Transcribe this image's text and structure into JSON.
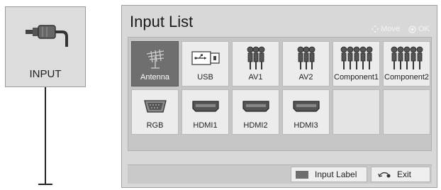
{
  "remote_button": {
    "label": "INPUT",
    "icon": "input-plug-icon"
  },
  "panel": {
    "title": "Input List",
    "hints": {
      "move": "Move",
      "ok": "OK"
    },
    "row1": [
      {
        "label": "Antenna",
        "icon": "antenna-icon",
        "selected": true
      },
      {
        "label": "USB",
        "icon": "usb-icon",
        "selected": false
      },
      {
        "label": "AV1",
        "icon": "av-connector-icon",
        "selected": false
      },
      {
        "label": "AV2",
        "icon": "av-connector-icon",
        "selected": false
      },
      {
        "label": "Component1",
        "icon": "component-connector-icon",
        "selected": false
      },
      {
        "label": "Component2",
        "icon": "component-connector-icon",
        "selected": false
      }
    ],
    "row2": [
      {
        "label": "RGB",
        "icon": "rgb-port-icon",
        "selected": false
      },
      {
        "label": "HDMI1",
        "icon": "hdmi-port-icon",
        "selected": false
      },
      {
        "label": "HDMI2",
        "icon": "hdmi-port-icon",
        "selected": false
      },
      {
        "label": "HDMI3",
        "icon": "hdmi-port-icon",
        "selected": false
      },
      {
        "label": "",
        "icon": "",
        "selected": false
      },
      {
        "label": "",
        "icon": "",
        "selected": false
      }
    ],
    "bottom": {
      "input_label": "Input Label",
      "exit": "Exit"
    }
  },
  "colors": {
    "selected_tile": "#6f6f6f",
    "panel_bg": "#d8d8d8",
    "tile_bg": "#ececec"
  }
}
